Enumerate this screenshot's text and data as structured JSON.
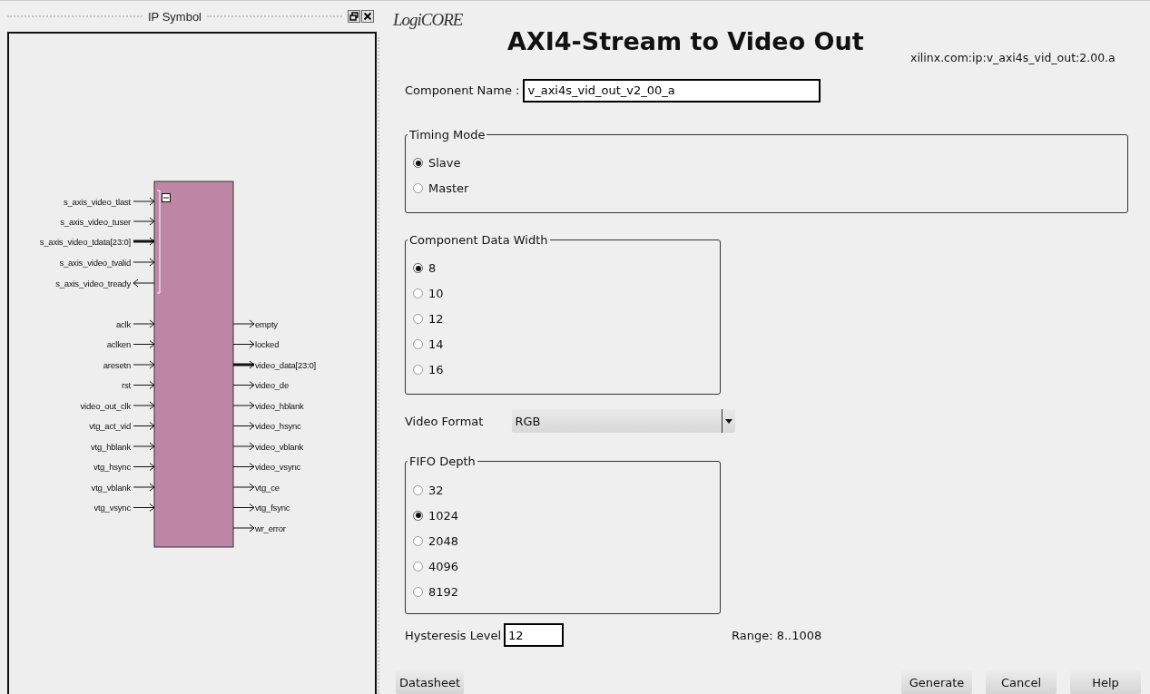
{
  "symbol_panel": {
    "title": "IP Symbol",
    "interface": {
      "expanded": true,
      "pins": [
        {
          "name": "s_axis_video_tlast",
          "kind": "wire",
          "outgoing": false
        },
        {
          "name": "s_axis_video_tuser",
          "kind": "wire",
          "outgoing": false
        },
        {
          "name": "s_axis_video_tdata[23:0]",
          "kind": "bus",
          "outgoing": false
        },
        {
          "name": "s_axis_video_tvalid",
          "kind": "wire",
          "outgoing": false
        },
        {
          "name": "s_axis_video_tready",
          "kind": "wire",
          "outgoing": true
        }
      ]
    },
    "inputs": [
      {
        "name": "aclk",
        "kind": "wire"
      },
      {
        "name": "aclken",
        "kind": "wire"
      },
      {
        "name": "aresetn",
        "kind": "wire"
      },
      {
        "name": "rst",
        "kind": "wire"
      },
      {
        "name": "video_out_clk",
        "kind": "wire"
      },
      {
        "name": "vtg_act_vid",
        "kind": "wire"
      },
      {
        "name": "vtg_hblank",
        "kind": "wire"
      },
      {
        "name": "vtg_hsync",
        "kind": "wire"
      },
      {
        "name": "vtg_vblank",
        "kind": "wire"
      },
      {
        "name": "vtg_vsync",
        "kind": "wire"
      }
    ],
    "outputs": [
      {
        "name": "empty",
        "kind": "wire"
      },
      {
        "name": "locked",
        "kind": "wire"
      },
      {
        "name": "video_data[23:0]",
        "kind": "bus"
      },
      {
        "name": "video_de",
        "kind": "wire"
      },
      {
        "name": "video_hblank",
        "kind": "wire"
      },
      {
        "name": "video_hsync",
        "kind": "wire"
      },
      {
        "name": "video_vblank",
        "kind": "wire"
      },
      {
        "name": "video_vsync",
        "kind": "wire"
      },
      {
        "name": "vtg_ce",
        "kind": "wire"
      },
      {
        "name": "vtg_fsync",
        "kind": "wire"
      },
      {
        "name": "wr_error",
        "kind": "wire"
      }
    ]
  },
  "header": {
    "logo": "LogiCORE",
    "title": "AXI4-Stream to Video Out",
    "vlnv": "xilinx.com:ip:v_axi4s_vid_out:2.00.a"
  },
  "component_name": {
    "label": "Component Name :",
    "value": "v_axi4s_vid_out_v2_00_a"
  },
  "timing_mode": {
    "title": "Timing Mode",
    "options": [
      {
        "label": "Slave",
        "selected": true
      },
      {
        "label": "Master",
        "selected": false
      }
    ]
  },
  "component_data_width": {
    "title": "Component Data Width",
    "options": [
      {
        "label": "8",
        "selected": true
      },
      {
        "label": "10",
        "selected": false
      },
      {
        "label": "12",
        "selected": false
      },
      {
        "label": "14",
        "selected": false
      },
      {
        "label": "16",
        "selected": false
      }
    ]
  },
  "video_format": {
    "label": "Video Format",
    "value": "RGB"
  },
  "fifo_depth": {
    "title": "FIFO Depth",
    "options": [
      {
        "label": "32",
        "selected": false
      },
      {
        "label": "1024",
        "selected": true
      },
      {
        "label": "2048",
        "selected": false
      },
      {
        "label": "4096",
        "selected": false
      },
      {
        "label": "8192",
        "selected": false
      }
    ]
  },
  "hysteresis_level": {
    "label": "Hysteresis Level",
    "value": "12",
    "range": "Range: 8..1008"
  },
  "buttons": {
    "left": [
      "Datasheet"
    ],
    "right": [
      "Generate",
      "Cancel",
      "Help"
    ]
  }
}
